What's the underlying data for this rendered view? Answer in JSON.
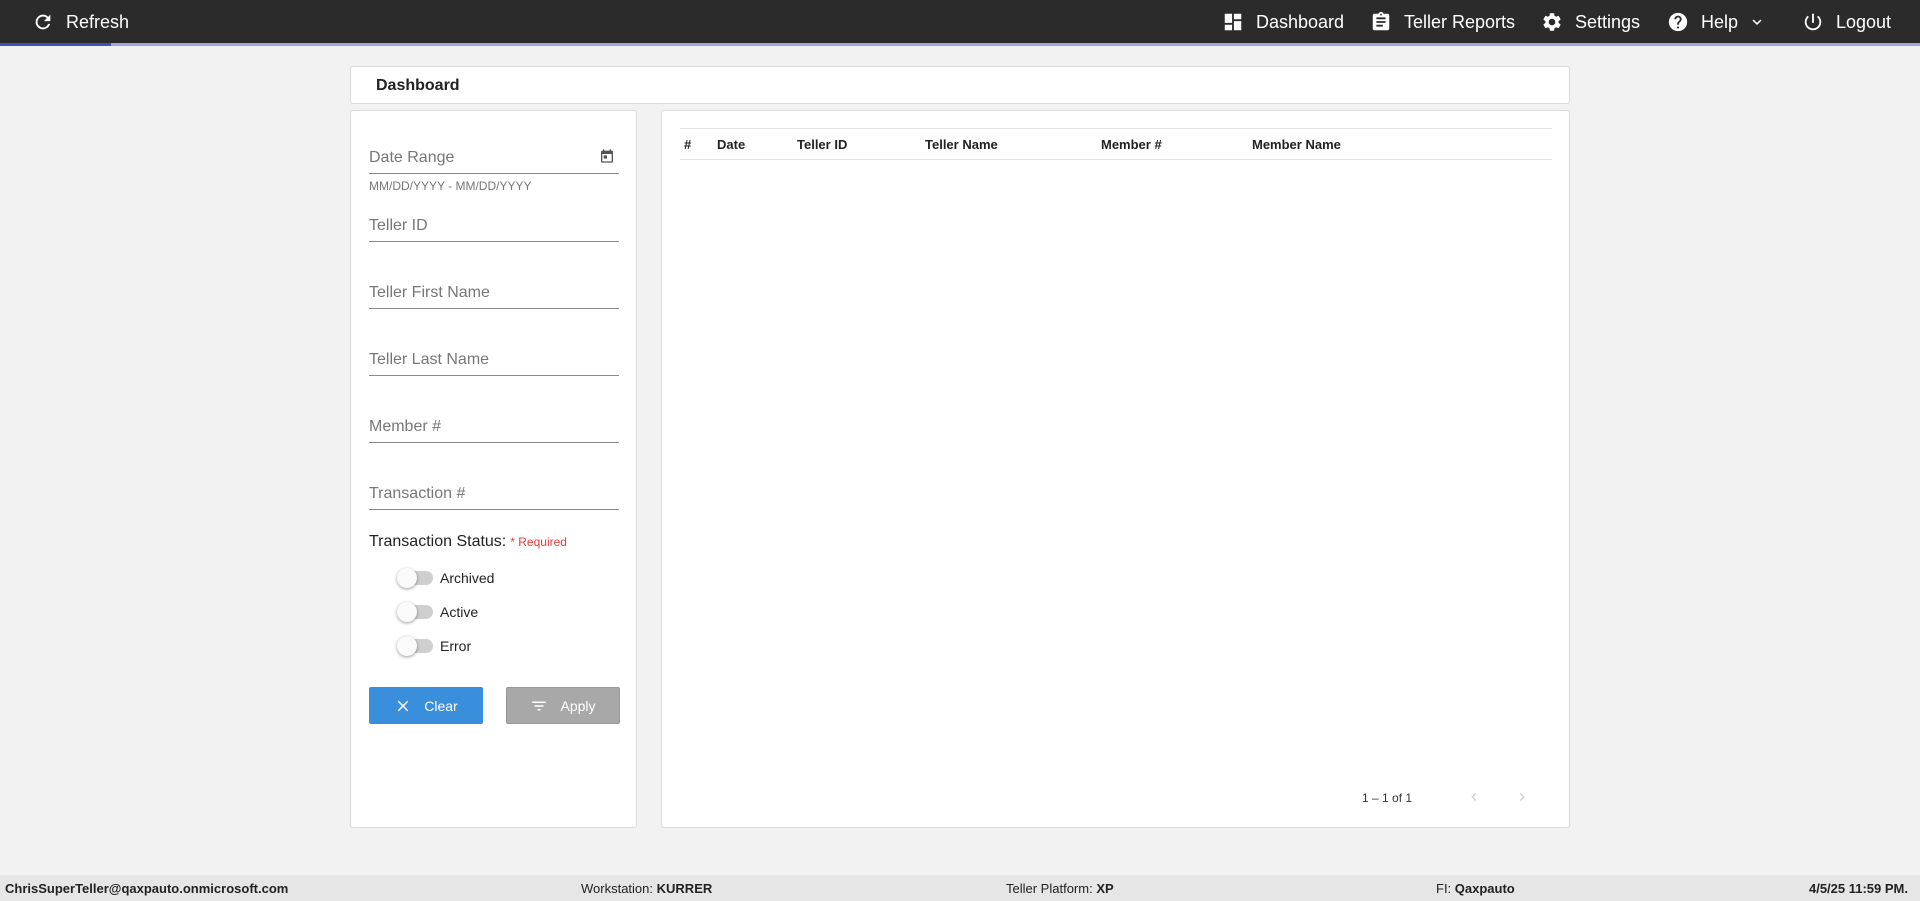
{
  "topbar": {
    "refresh_label": "Refresh",
    "nav": {
      "dashboard": "Dashboard",
      "teller_reports": "Teller Reports",
      "settings": "Settings",
      "help": "Help",
      "logout": "Logout"
    },
    "progress": 0.058
  },
  "page_title": "Dashboard",
  "filters": {
    "date_range": {
      "placeholder": "Date Range",
      "hint": "MM/DD/YYYY - MM/DD/YYYY"
    },
    "teller_id": "Teller ID",
    "teller_first_name": "Teller First Name",
    "teller_last_name": "Teller Last Name",
    "member_number": "Member #",
    "transaction_number": "Transaction #",
    "status_label": "Transaction Status:",
    "required_label": "* Required",
    "toggles": [
      {
        "label": "Archived",
        "on": false
      },
      {
        "label": "Active",
        "on": false
      },
      {
        "label": "Error",
        "on": false
      }
    ],
    "clear_label": "Clear",
    "apply_label": "Apply"
  },
  "table": {
    "columns": [
      "#",
      "Date",
      "Teller ID",
      "Teller Name",
      "Member #",
      "Member Name"
    ],
    "rows": [],
    "pagination": "1 – 1 of 1"
  },
  "footer": {
    "user": "ChrisSuperTeller@qaxpauto.onmicrosoft.com",
    "workstation_label": "Workstation:",
    "workstation": "KURRER",
    "platform_label": "Teller Platform:",
    "platform": "XP",
    "fi_label": "FI:",
    "fi": "Qaxpauto",
    "datetime": "4/5/25 11:59 PM."
  },
  "colors": {
    "topbar": "#2b2b2b",
    "accent": "#3a8fdc",
    "required": "#e53935",
    "disabled": "#a8a8a8"
  }
}
